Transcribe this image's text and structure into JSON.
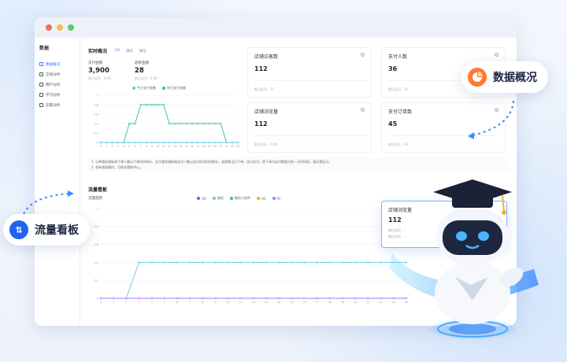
{
  "sidebar": {
    "title": "数据",
    "items": [
      {
        "label": "数据概况",
        "active": true
      },
      {
        "label": "交易分析"
      },
      {
        "label": "用户分析"
      },
      {
        "label": "学习分析"
      },
      {
        "label": "流量分析"
      }
    ]
  },
  "realtime": {
    "title": "实时概况",
    "tabs": [
      "H5",
      "微信",
      "微信"
    ],
    "stats": [
      {
        "label": "支付金额",
        "value": "3,900",
        "sub": "前日全天：0.00"
      },
      {
        "label": "退款金额",
        "value": "28",
        "sub": "前日全天：0.00"
      }
    ],
    "legend": [
      "今日支付金额",
      "昨日支付金额"
    ]
  },
  "cards": [
    {
      "title": "店铺访客数",
      "value": "112",
      "sub": "前日全天：73"
    },
    {
      "title": "支付人数",
      "value": "36",
      "sub": "前日全天：32"
    },
    {
      "title": "店铺浏览量",
      "value": "112",
      "sub": "前日全天：0.00"
    },
    {
      "title": "支付订单数",
      "value": "45",
      "sub": "前日全天：24"
    }
  ],
  "notes": [
    "1. 订单相关指标按下单人数以下单时间统计，支付相关指标按支付人数以支付成功时间统计，若顾客当日下单，次日支付，则下单与支付数据分别一天时间段，请注意区分。",
    "2. 若有其他疑问，可前往帮助中心。"
  ],
  "traffic": {
    "title": "流量看板",
    "subtitle": "流量趋势",
    "legend": [
      {
        "name": "H5",
        "color": "#3a7afe"
      },
      {
        "name": "微信",
        "color": "#5ec8f2"
      },
      {
        "name": "微信小程序",
        "color": "#2fc28a"
      },
      {
        "name": "H5",
        "color": "#f5a623"
      },
      {
        "name": "PC",
        "color": "#9b7bf5"
      }
    ]
  },
  "float_card": {
    "title": "店铺浏览量",
    "value": "112",
    "line1": "前日全天：--",
    "line2": "前日全天：--"
  },
  "pills": {
    "data_overview": "数据概况",
    "traffic_board": "流量看板"
  },
  "chart_data": [
    {
      "type": "line",
      "x": [
        "0",
        "1",
        "2",
        "3",
        "4",
        "5",
        "6",
        "7",
        "8",
        "9",
        "10",
        "11",
        "12",
        "13",
        "14",
        "15",
        "16",
        "17",
        "18",
        "19",
        "20",
        "21",
        "22",
        "23",
        "24"
      ],
      "yticks": [
        "0",
        "0.2",
        "0.4",
        "0.6",
        "0.8",
        "1"
      ],
      "ylim": [
        0,
        1
      ],
      "series": [
        {
          "name": "今日支付金额",
          "color": "#2fc28a",
          "values": [
            0,
            0,
            0,
            0,
            0,
            0.4,
            0.4,
            0.8,
            0.8,
            0.8,
            0.8,
            0.8,
            0.4,
            0.4,
            0.4,
            0.4,
            0.4,
            0.4,
            0.4,
            0.4,
            0.4,
            0.4,
            0,
            0,
            0
          ]
        },
        {
          "name": "昨日支付金额",
          "color": "#5ec8f2",
          "values": [
            0,
            0,
            0,
            0,
            0,
            0,
            0,
            0,
            0,
            0,
            0,
            0,
            0,
            0,
            0,
            0,
            0,
            0,
            0,
            0,
            0,
            0,
            0,
            0,
            0
          ]
        }
      ]
    },
    {
      "type": "line",
      "x": [
        "0",
        "1",
        "2",
        "3",
        "4",
        "5",
        "6",
        "7",
        "8",
        "9",
        "10",
        "11",
        "12",
        "13",
        "14",
        "15",
        "16",
        "17",
        "18",
        "19",
        "20",
        "21",
        "22",
        "23",
        "24"
      ],
      "yticks": [
        "0",
        "0.2",
        "0.4",
        "0.6",
        "0.8",
        "1"
      ],
      "ylim": [
        0,
        1
      ],
      "series": [
        {
          "name": "微信",
          "color": "#5ec8f2",
          "values": [
            0,
            0,
            0,
            0.4,
            0.4,
            0.4,
            0.4,
            0.4,
            0.4,
            0.4,
            0.4,
            0.4,
            0.4,
            0.4,
            0.4,
            0.4,
            0.4,
            0.4,
            0.4,
            0.4,
            0.4,
            0.4,
            0.4,
            0.4,
            0.4
          ]
        },
        {
          "name": "PC",
          "color": "#9b7bf5",
          "values": [
            0,
            0,
            0,
            0,
            0,
            0,
            0,
            0,
            0,
            0,
            0,
            0,
            0,
            0,
            0,
            0,
            0,
            0,
            0,
            0,
            0,
            0,
            0,
            0,
            0
          ]
        }
      ]
    }
  ]
}
